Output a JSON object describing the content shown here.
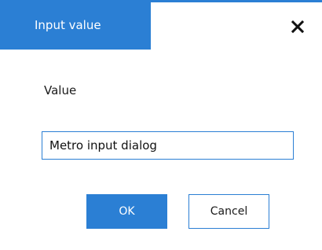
{
  "dialog": {
    "title": "Input value",
    "close_icon": "close-icon",
    "field_label": "Value",
    "input_value": "Metro input dialog",
    "ok_label": "OK",
    "cancel_label": "Cancel"
  },
  "colors": {
    "accent": "#2b7fd4",
    "background": "#ffffff",
    "text": "#1a1a1a"
  }
}
